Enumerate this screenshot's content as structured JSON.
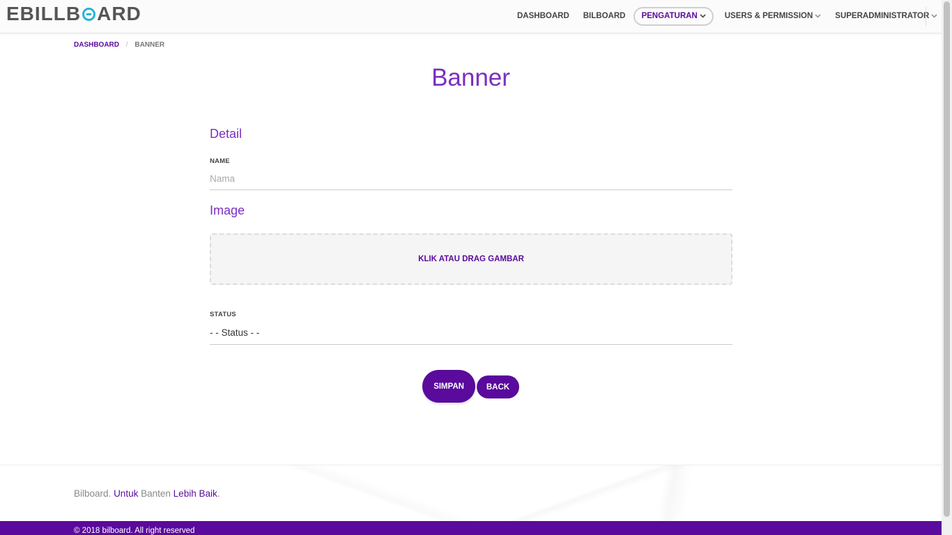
{
  "brand": {
    "logo_left": "EBILLB",
    "logo_right": "ARD"
  },
  "nav": {
    "items": [
      {
        "label": "DASHBOARD",
        "active": false,
        "dropdown": false
      },
      {
        "label": "BILBOARD",
        "active": false,
        "dropdown": false
      },
      {
        "label": "PENGATURAN",
        "active": true,
        "dropdown": true
      },
      {
        "label": "USERS & PERMISSION",
        "active": false,
        "dropdown": true
      },
      {
        "label": "SUPERADMINISTRATOR",
        "active": false,
        "dropdown": true
      }
    ]
  },
  "breadcrumb": {
    "home": "DASHBOARD",
    "separator": "/",
    "current": "BANNER"
  },
  "page": {
    "title": "Banner"
  },
  "form": {
    "detail_heading": "Detail",
    "name_label": "NAME",
    "name_placeholder": "Nama",
    "name_value": "",
    "image_heading": "Image",
    "dropzone_label": "KLIK ATAU DRAG GAMBAR",
    "status_label": "STATUS",
    "status_selected": "- - Status - -",
    "save_label": "SIMPAN",
    "back_label": "BACK"
  },
  "footer": {
    "part1": "Bilboard.",
    "part2": "Untuk",
    "part3": "Banten",
    "part4": "Lebih Baik",
    "part5": ".",
    "copyright": "© 2018 bilboard. All right reserved"
  },
  "colors": {
    "accent": "#5a0a9c",
    "title": "#7b2fc0",
    "logo_ring": "#28b3d6"
  }
}
